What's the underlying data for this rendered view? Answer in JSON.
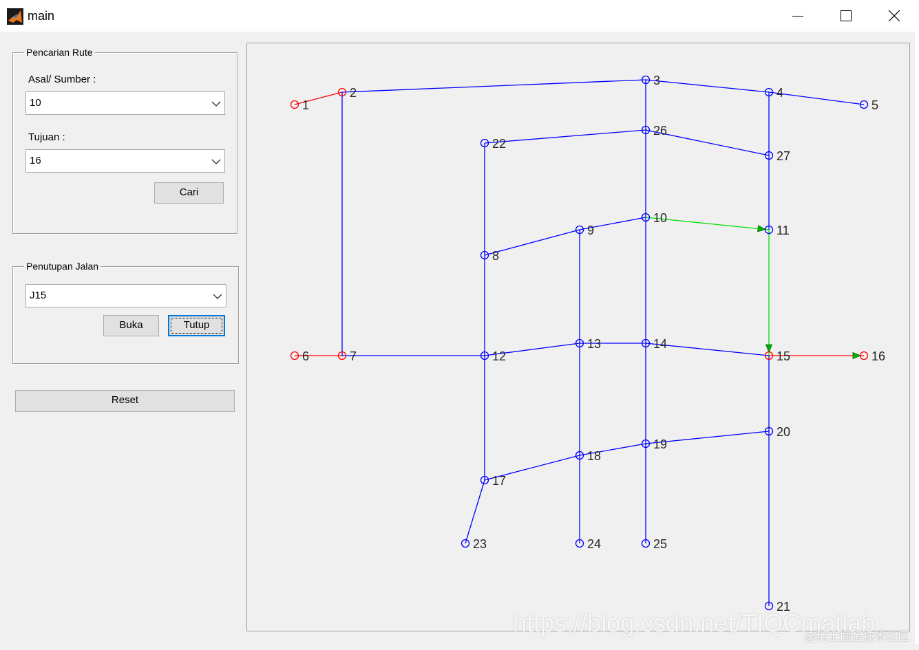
{
  "window": {
    "title": "main",
    "icon": "matlab-icon",
    "controls": [
      "minimize-icon",
      "maximize-icon",
      "close-icon"
    ]
  },
  "route_panel": {
    "title": "Pencarian Rute",
    "source_label": "Asal/ Sumber :",
    "source_value": "10",
    "dest_label": "Tujuan :",
    "dest_value": "16",
    "search_button": "Cari"
  },
  "closure_panel": {
    "title": "Penutupan Jalan",
    "road_value": "J15",
    "open_button": "Buka",
    "close_button": "Tutup"
  },
  "reset_button": "Reset",
  "watermark": {
    "url": "https://blog.csdn.net/TIQCmatlab",
    "credit": "@稀土掘金技术社区"
  },
  "colors": {
    "road": "#0000ff",
    "closed_road": "#ff0000",
    "route": "#00dd00",
    "route_arrow": "#00b000"
  },
  "graph": {
    "nodes": [
      {
        "id": "1",
        "status": "closed"
      },
      {
        "id": "2",
        "status": "closed"
      },
      {
        "id": "3",
        "status": "normal"
      },
      {
        "id": "4",
        "status": "normal"
      },
      {
        "id": "5",
        "status": "normal"
      },
      {
        "id": "6",
        "status": "closed"
      },
      {
        "id": "7",
        "status": "closed"
      },
      {
        "id": "8",
        "status": "normal"
      },
      {
        "id": "9",
        "status": "normal"
      },
      {
        "id": "10",
        "status": "normal"
      },
      {
        "id": "11",
        "status": "normal"
      },
      {
        "id": "12",
        "status": "normal"
      },
      {
        "id": "13",
        "status": "normal"
      },
      {
        "id": "14",
        "status": "normal"
      },
      {
        "id": "15",
        "status": "closed"
      },
      {
        "id": "16",
        "status": "closed"
      },
      {
        "id": "17",
        "status": "normal"
      },
      {
        "id": "18",
        "status": "normal"
      },
      {
        "id": "19",
        "status": "normal"
      },
      {
        "id": "20",
        "status": "normal"
      },
      {
        "id": "21",
        "status": "normal"
      },
      {
        "id": "22",
        "status": "normal"
      },
      {
        "id": "23",
        "status": "normal"
      },
      {
        "id": "24",
        "status": "normal"
      },
      {
        "id": "25",
        "status": "normal"
      },
      {
        "id": "26",
        "status": "normal"
      },
      {
        "id": "27",
        "status": "normal"
      }
    ],
    "edges": [
      {
        "from": "1",
        "to": "2",
        "status": "closed"
      },
      {
        "from": "2",
        "to": "3",
        "status": "normal"
      },
      {
        "from": "3",
        "to": "4",
        "status": "normal"
      },
      {
        "from": "4",
        "to": "5",
        "status": "normal"
      },
      {
        "from": "2",
        "to": "7",
        "status": "normal"
      },
      {
        "from": "6",
        "to": "7",
        "status": "closed"
      },
      {
        "from": "7",
        "to": "12",
        "status": "normal"
      },
      {
        "from": "22",
        "to": "26",
        "status": "normal"
      },
      {
        "from": "26",
        "to": "27",
        "status": "normal"
      },
      {
        "from": "3",
        "to": "26",
        "status": "normal"
      },
      {
        "from": "26",
        "to": "10",
        "status": "normal"
      },
      {
        "from": "10",
        "to": "14",
        "status": "normal"
      },
      {
        "from": "14",
        "to": "19",
        "status": "normal"
      },
      {
        "from": "19",
        "to": "25",
        "status": "normal"
      },
      {
        "from": "4",
        "to": "27",
        "status": "normal"
      },
      {
        "from": "27",
        "to": "11",
        "status": "normal"
      },
      {
        "from": "22",
        "to": "8",
        "status": "normal"
      },
      {
        "from": "8",
        "to": "12",
        "status": "normal"
      },
      {
        "from": "12",
        "to": "17",
        "status": "normal"
      },
      {
        "from": "17",
        "to": "23",
        "status": "normal"
      },
      {
        "from": "8",
        "to": "9",
        "status": "normal"
      },
      {
        "from": "9",
        "to": "10",
        "status": "normal"
      },
      {
        "from": "9",
        "to": "13",
        "status": "normal"
      },
      {
        "from": "13",
        "to": "18",
        "status": "normal"
      },
      {
        "from": "18",
        "to": "24",
        "status": "normal"
      },
      {
        "from": "12",
        "to": "13",
        "status": "normal"
      },
      {
        "from": "13",
        "to": "14",
        "status": "normal"
      },
      {
        "from": "14",
        "to": "15",
        "status": "normal"
      },
      {
        "from": "15",
        "to": "20",
        "status": "normal"
      },
      {
        "from": "20",
        "to": "21",
        "status": "normal"
      },
      {
        "from": "17",
        "to": "18",
        "status": "normal"
      },
      {
        "from": "18",
        "to": "19",
        "status": "normal"
      },
      {
        "from": "19",
        "to": "20",
        "status": "normal"
      },
      {
        "from": "10",
        "to": "11",
        "status": "route"
      },
      {
        "from": "11",
        "to": "15",
        "status": "route"
      },
      {
        "from": "15",
        "to": "16",
        "status": "closed"
      }
    ]
  }
}
